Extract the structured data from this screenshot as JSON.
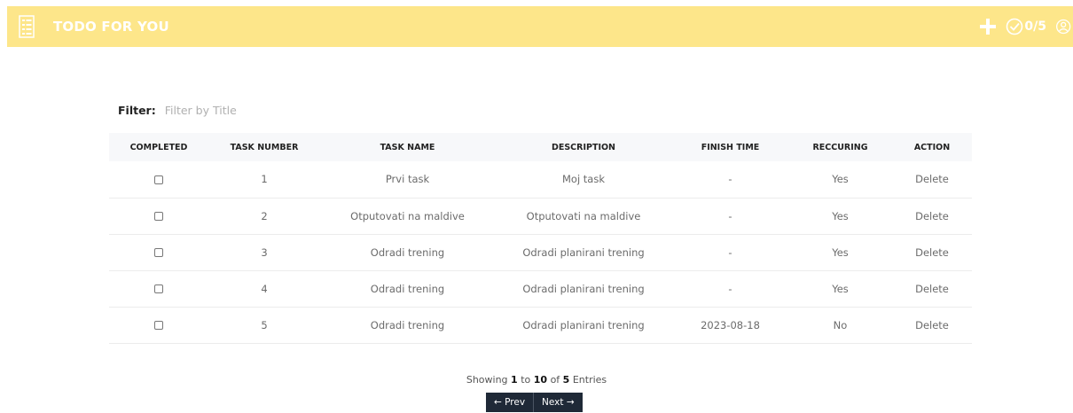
{
  "header": {
    "title": "TODO FOR YOU",
    "logo_icon": "list-icon",
    "add_icon": "plus-icon",
    "check_icon": "check-circle-icon",
    "counter": "0/5",
    "user_icon": "user-circle-icon",
    "bg_color": "#fde68a"
  },
  "filter": {
    "label": "Filter:",
    "placeholder": "Filter by Title",
    "value": ""
  },
  "table": {
    "columns": [
      "COMPLETED",
      "TASK NUMBER",
      "TASK NAME",
      "DESCRIPTION",
      "FINISH TIME",
      "RECCURING",
      "ACTION"
    ],
    "rows": [
      {
        "number": "1",
        "name": "Prvi task",
        "description": "Moj task",
        "finish": "-",
        "recurring": "Yes",
        "action": "Delete"
      },
      {
        "number": "2",
        "name": "Otputovati na maldive",
        "description": "Otputovati na maldive",
        "finish": "-",
        "recurring": "Yes",
        "action": "Delete"
      },
      {
        "number": "3",
        "name": "Odradi trening",
        "description": "Odradi planirani trening",
        "finish": "-",
        "recurring": "Yes",
        "action": "Delete"
      },
      {
        "number": "4",
        "name": "Odradi trening",
        "description": "Odradi planirani trening",
        "finish": "-",
        "recurring": "Yes",
        "action": "Delete"
      },
      {
        "number": "5",
        "name": "Odradi trening",
        "description": "Odradi planirani trening",
        "finish": "2023-08-18",
        "recurring": "No",
        "action": "Delete"
      }
    ]
  },
  "pagination": {
    "showing_prefix": "Showing",
    "from": "1",
    "to_word": "to",
    "to": "10",
    "of_word": "of",
    "total": "5",
    "suffix": "Entries",
    "prev": "← Prev",
    "next": "Next →"
  }
}
